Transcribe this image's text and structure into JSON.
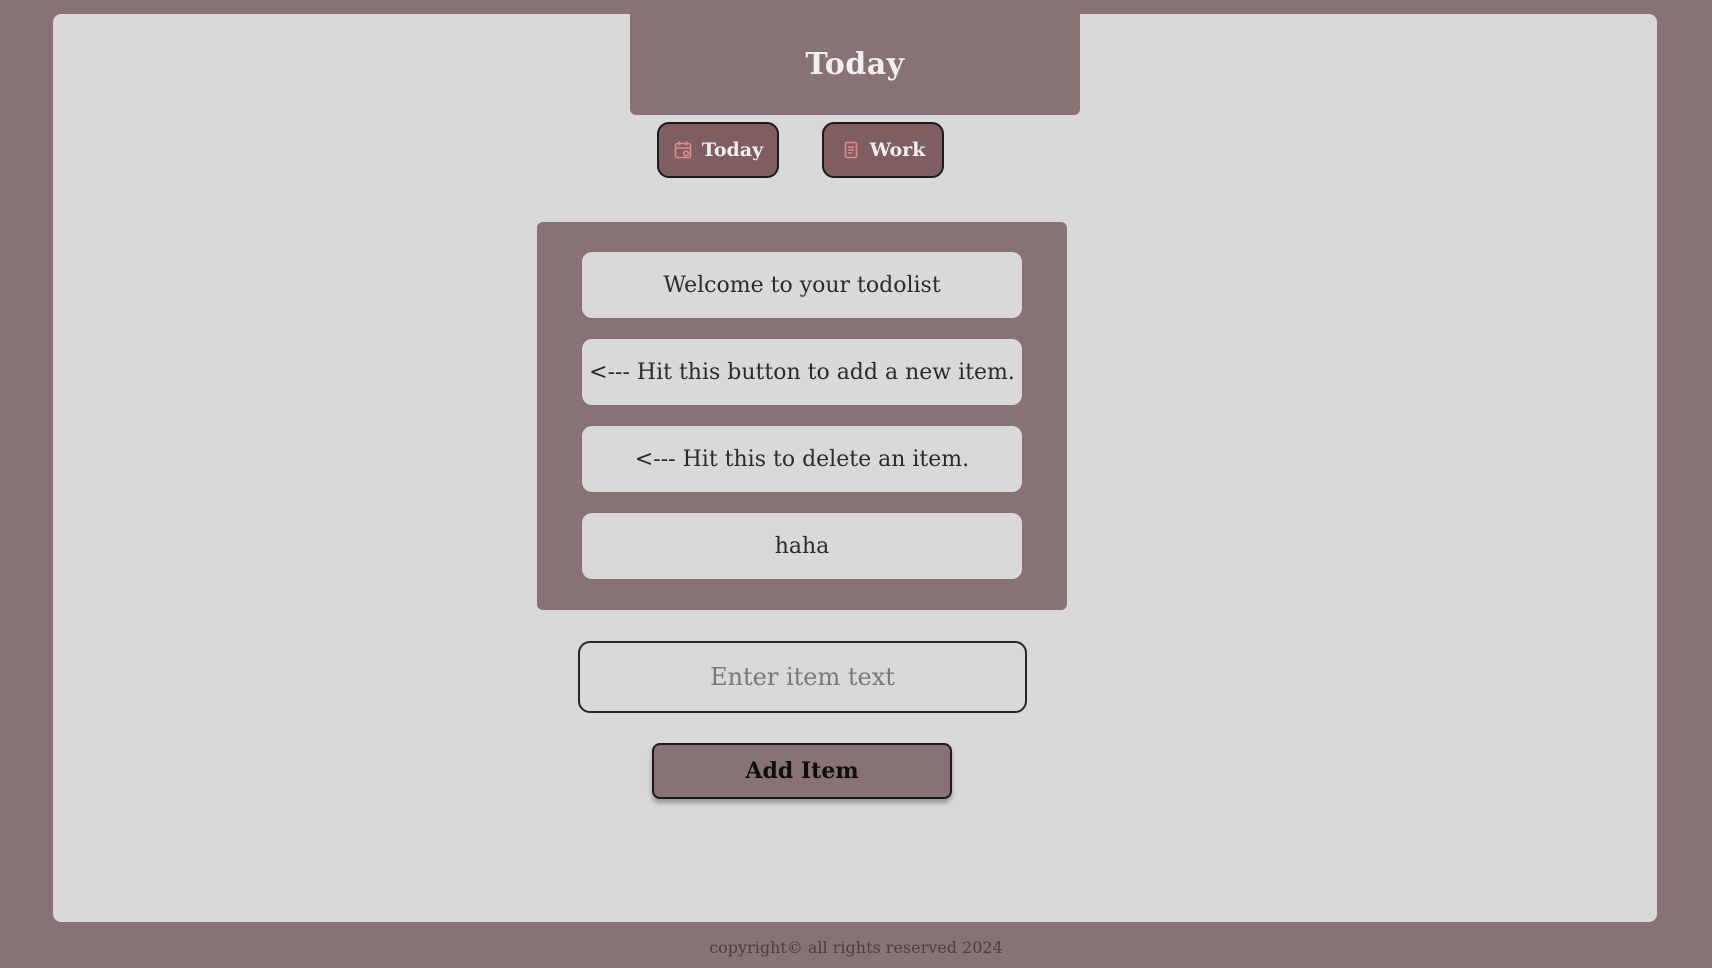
{
  "header": {
    "title": "Today"
  },
  "nav": {
    "today_label": "Today",
    "today_icon": "calendar-icon",
    "work_label": "Work",
    "work_icon": "notepad-icon"
  },
  "list": {
    "items": [
      "Welcome to your todolist",
      "<--- Hit this button to add a new item.",
      "<--- Hit this to delete an item.",
      "haha"
    ]
  },
  "form": {
    "input_placeholder": "Enter item text",
    "input_value": "",
    "add_label": "Add Item"
  },
  "footer": {
    "text": "copyright© all rights reserved 2024"
  },
  "colors": {
    "background": "#897274",
    "panel": "#d9d9da",
    "nav_button": "#7f5d60",
    "icon_accent": "#e08c8c"
  }
}
